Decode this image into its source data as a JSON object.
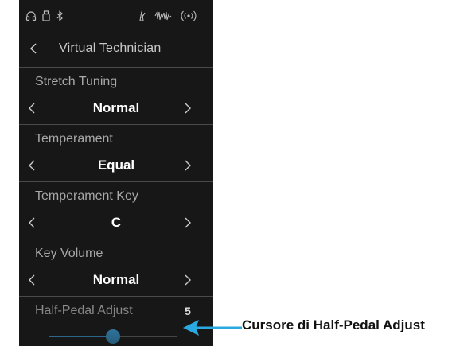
{
  "header": {
    "title": "Virtual Technician",
    "back_icon": "chevron-left-icon"
  },
  "status_icons": [
    "headphones-icon",
    "usb-memory-icon",
    "bluetooth-icon",
    "metronome-icon",
    "recorder-icon",
    "wireless-icon"
  ],
  "settings": [
    {
      "label": "Stretch Tuning",
      "value": "Normal"
    },
    {
      "label": "Temperament",
      "value": "Equal"
    },
    {
      "label": "Temperament Key",
      "value": "C"
    },
    {
      "label": "Key Volume",
      "value": "Normal"
    }
  ],
  "half_pedal": {
    "label": "Half-Pedal Adjust",
    "value": "5",
    "slider_fraction": 0.5
  },
  "callout": {
    "text": "Cursore di Half-Pedal Adjust"
  },
  "colors": {
    "screen_bg": "#171717",
    "accent": "#3aa7e6",
    "callout_arrow": "#29a9e0"
  }
}
